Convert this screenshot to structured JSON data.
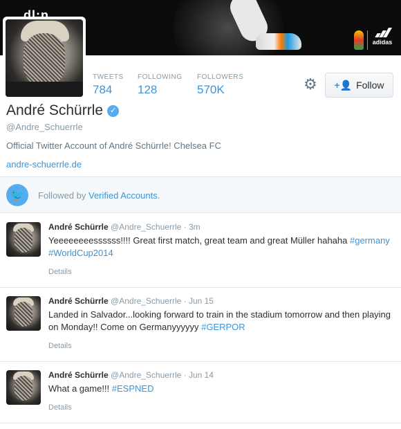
{
  "banner": {
    "corner_text": "dl;n",
    "brand": "adidas"
  },
  "profile": {
    "name": "André Schürrle",
    "verified_badge": "✓",
    "handle": "@Andre_Schuerrle",
    "bio": "Official Twitter Account of André Schürrle! Chelsea FC",
    "url": "andre-schuerrle.de"
  },
  "stats": [
    {
      "label": "TWEETS",
      "value": "784"
    },
    {
      "label": "FOLLOWING",
      "value": "128"
    },
    {
      "label": "FOLLOWERS",
      "value": "570K"
    }
  ],
  "actions": {
    "follow_label": "Follow",
    "settings_icon": "gear-icon"
  },
  "followed_by": {
    "prefix": "Followed by ",
    "link": "Verified Accounts",
    "suffix": "."
  },
  "tweets": [
    {
      "name": "André Schürrle",
      "handle": "@Andre_Schuerrle",
      "time": "· 3m",
      "text": "Yeeeeeeeessssss!!!! Great first match, great team and great Müller hahaha ",
      "tags": "#germany #WorldCup2014",
      "details": "Details"
    },
    {
      "name": "André Schürrle",
      "handle": "@Andre_Schuerrle",
      "time": "· Jun 15",
      "text": "Landed in Salvador...looking forward to train in the stadium tomorrow and then playing on Monday!! Come on Germanyyyyyy ",
      "tags": "#GERPOR",
      "details": "Details"
    },
    {
      "name": "André Schürrle",
      "handle": "@Andre_Schuerrle",
      "time": "· Jun 14",
      "text": "What a game!!! ",
      "tags": "#ESPNED",
      "details": "Details"
    }
  ],
  "colors": {
    "accent": "#3b94d9",
    "muted": "#8899a6",
    "text": "#292f33",
    "verified": "#55acee"
  }
}
